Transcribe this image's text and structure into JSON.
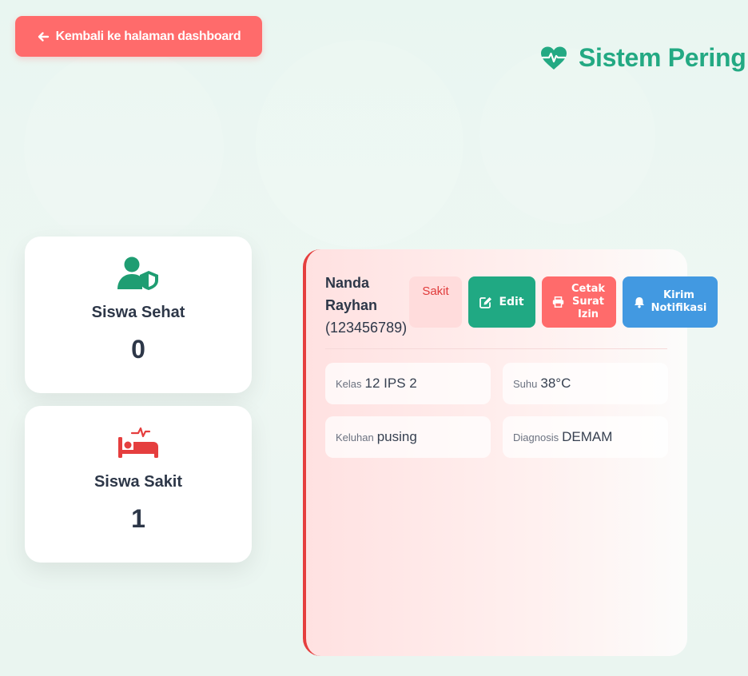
{
  "back_button": {
    "label": "Kembali ke halaman dashboard",
    "icon": "arrow-left-icon"
  },
  "brand": {
    "title": "Sistem Pering",
    "icon": "heart-pulse-icon",
    "color": "#23a983"
  },
  "stats": [
    {
      "label": "Siswa Sehat",
      "value": "0",
      "icon": "user-shield-icon",
      "color": "#1f9d72"
    },
    {
      "label": "Siswa Sakit",
      "value": "1",
      "icon": "bed-pulse-icon",
      "color": "#e53e3e"
    }
  ],
  "patient": {
    "name": "Nanda Rayhan",
    "id": "(123456789)",
    "status": "Sakit",
    "actions": {
      "edit": {
        "label": "Edit",
        "icon": "edit-icon",
        "color": "#20a983"
      },
      "print": {
        "label": "Cetak Surat Izin",
        "icon": "print-icon",
        "color": "#ff6b6b"
      },
      "notify": {
        "label": "Kirim Notifikasi",
        "icon": "bell-icon",
        "color": "#4299e1"
      }
    },
    "details": {
      "kelas": {
        "label": "Kelas",
        "value": "12 IPS 2"
      },
      "suhu": {
        "label": "Suhu",
        "value": "38°C"
      },
      "keluhan": {
        "label": "Keluhan",
        "value": "pusing"
      },
      "diagnosis": {
        "label": "Diagnosis",
        "value": "DEMAM"
      }
    },
    "accent": "#e53e3e"
  }
}
